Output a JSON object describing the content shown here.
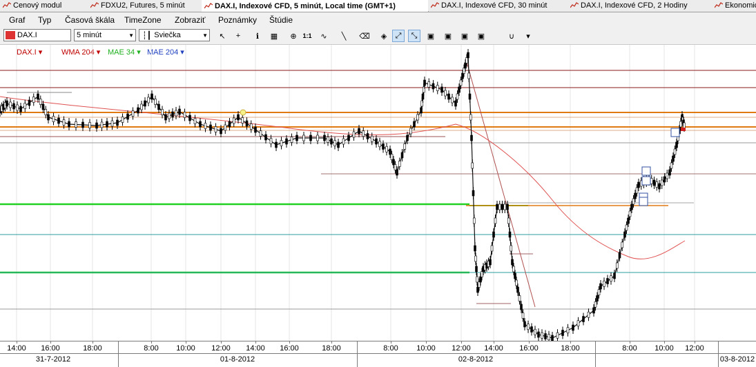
{
  "tabs": [
    {
      "label": "Cenový modul",
      "icon": "price-icon"
    },
    {
      "label": "FDXU2, Futures, 5 minút",
      "icon": "chart-icon"
    },
    {
      "label": "DAX.I, Indexové CFD, 5 minút, Local time (GMT+1)",
      "icon": "chart-icon",
      "active": true
    },
    {
      "label": "DAX.I, Indexové CFD, 30 minút",
      "icon": "chart-icon"
    },
    {
      "label": "DAX.I, Indexové CFD, 2 Hodiny",
      "icon": "chart-icon"
    },
    {
      "label": "Ekonomick",
      "icon": "chart-icon"
    }
  ],
  "menu": [
    "Graf",
    "Typ",
    "Časová škála",
    "TimeZone",
    "Zobraziť",
    "Poznámky",
    "Štúdie"
  ],
  "toolbar": {
    "symbol": "DAX.I",
    "interval": "5 minút",
    "chart_type": "Sviečka",
    "icons": [
      "cursor-icon",
      "crosshair-icon",
      "info-icon",
      "grid-icon",
      "zoom-icon",
      "ratio-icon",
      "wave-icon",
      "line-icon",
      "eraser-icon",
      "paint-icon",
      "trendline-icon",
      "fib-icon",
      "indicator-icon-1",
      "indicator-icon-2",
      "indicator-icon-3",
      "indicator-icon-4",
      "magnet-icon",
      "overflow-icon"
    ],
    "ratio_label": "1:1"
  },
  "legend": [
    {
      "label": "DAX.I",
      "color": "#c00000"
    },
    {
      "label": "WMA 204",
      "color": "#c00000"
    },
    {
      "label": "MAE 34",
      "color": "#20b020"
    },
    {
      "label": "MAE 204",
      "color": "#2040c0"
    }
  ],
  "time_ticks": [
    "14:00",
    "16:00",
    "18:00",
    "8:00",
    "10:00",
    "12:00",
    "14:00",
    "16:00",
    "18:00",
    "8:00",
    "10:00",
    "12:00",
    "14:00",
    "16:00",
    "18:00",
    "8:00",
    "10:00",
    "12:00"
  ],
  "dates": [
    "31-7-2012",
    "01-8-2012",
    "02-8-2012",
    "03-8-2012"
  ],
  "colors": {
    "orange": "#e07a10",
    "darkred": "#8b1a1a",
    "green": "#22d022",
    "teal": "#2a9d9d",
    "gray": "#9a9a9a"
  }
}
